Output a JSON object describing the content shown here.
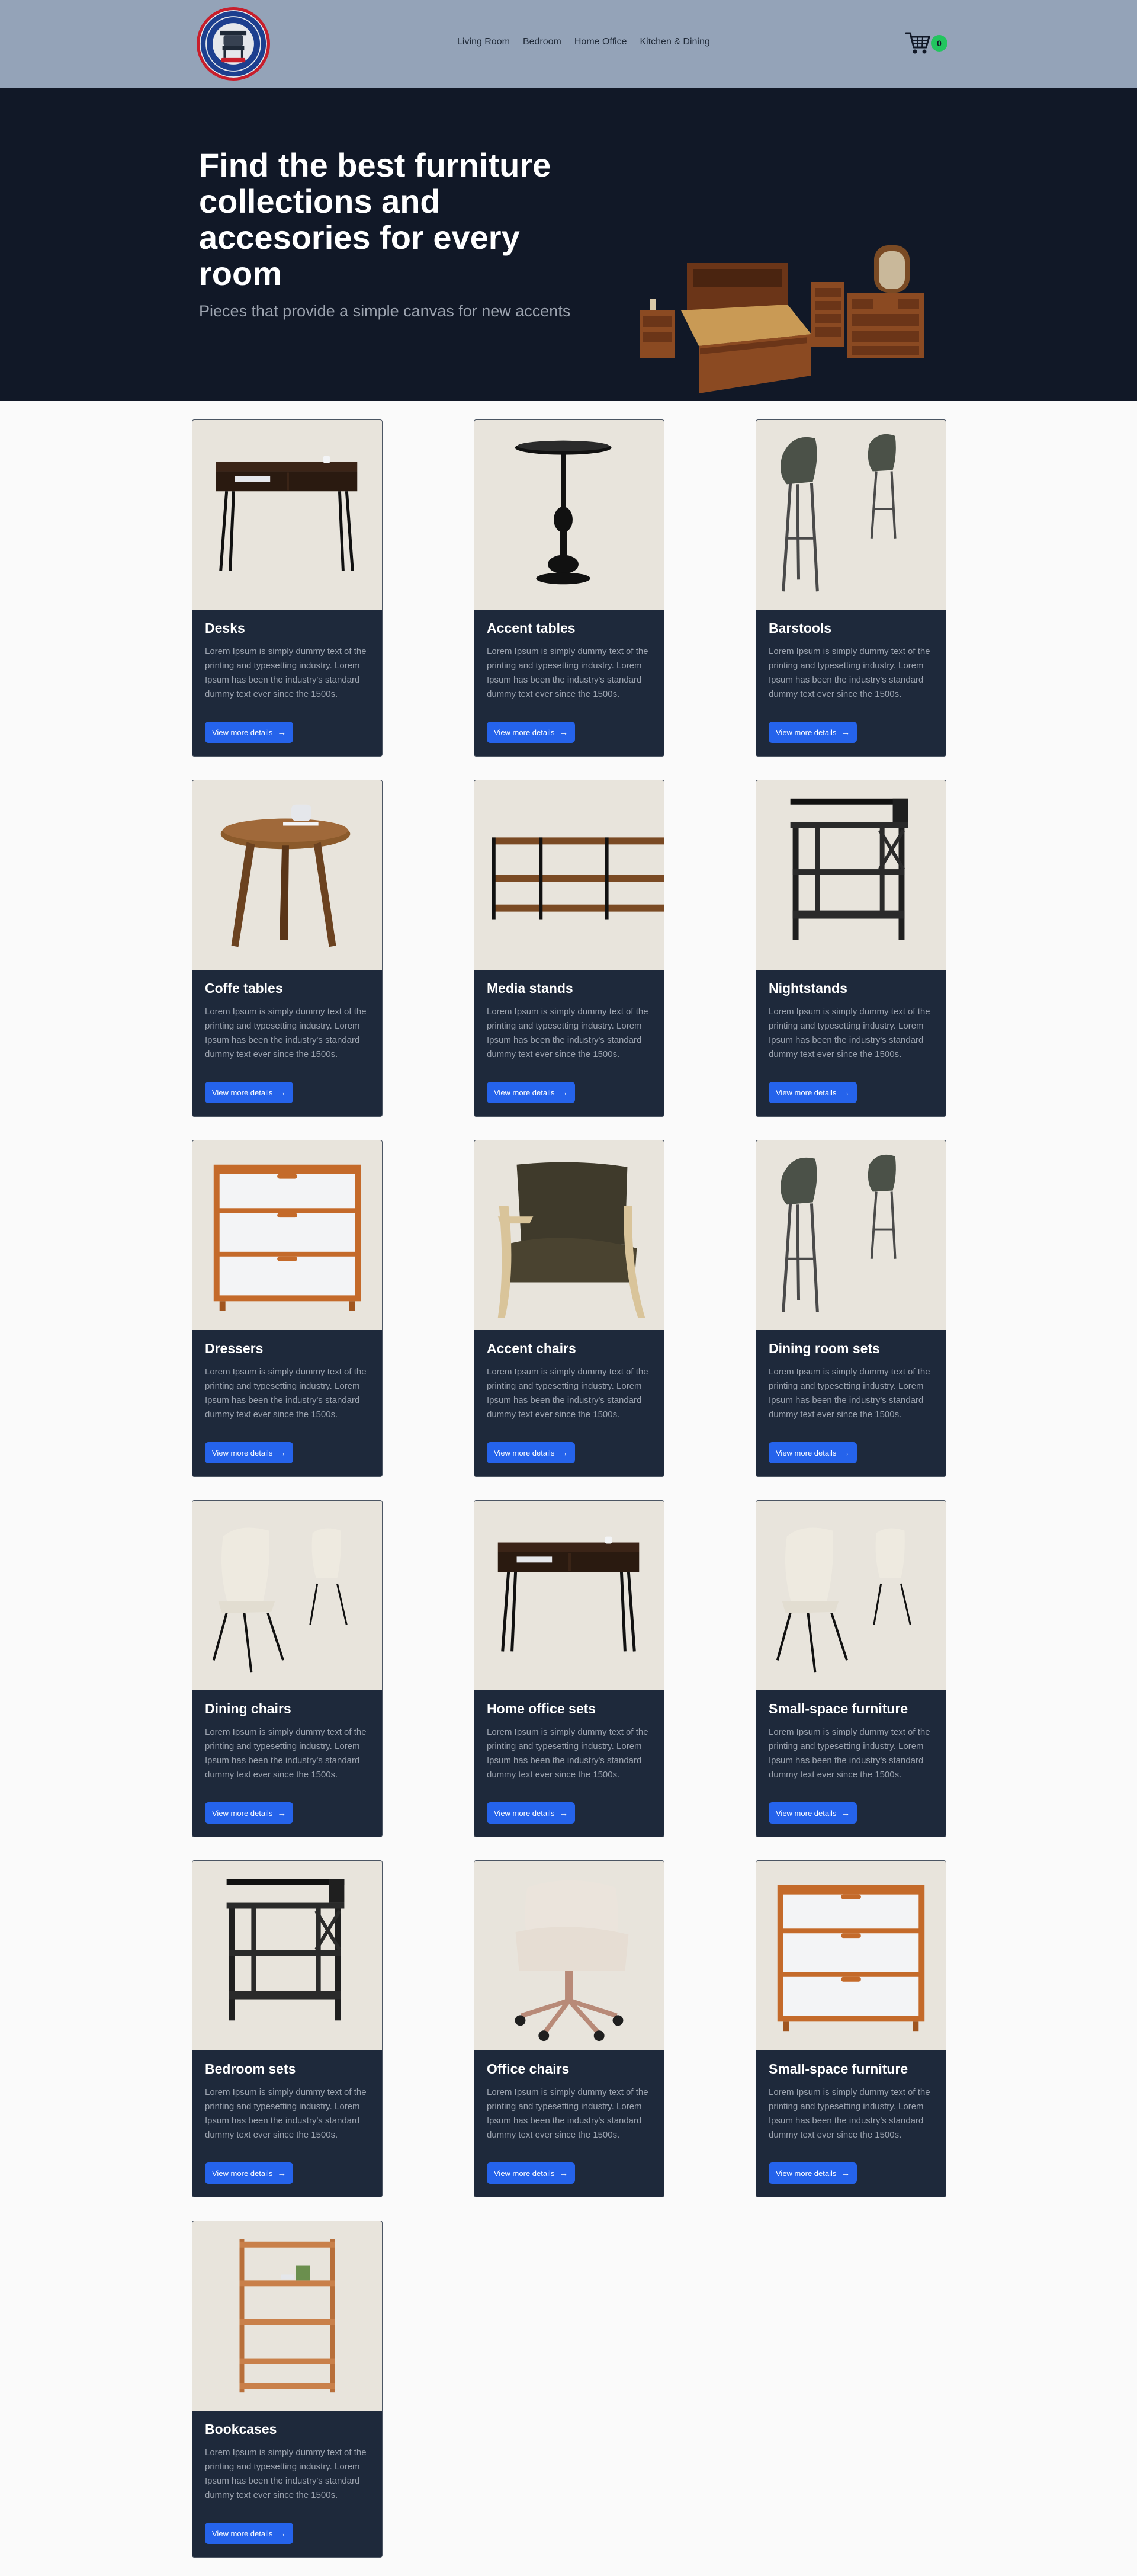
{
  "nav": {
    "items": [
      "Living Room",
      "Bedroom",
      "Home Office",
      "Kitchen & Dining"
    ]
  },
  "cart": {
    "count": "0"
  },
  "hero": {
    "title": "Find the best furniture collections and accesories for every room",
    "subtitle": "Pieces that provide a simple canvas for new accents"
  },
  "colors": {
    "header_bg": "#94a3b8",
    "hero_bg": "#111827",
    "card_bg": "#1e293b",
    "button_bg": "#2563eb",
    "cart_badge": "#22c55e"
  },
  "products": [
    {
      "title": "Desks",
      "desc": "Lorem Ipsum is simply dummy text of the printing and typesetting industry. Lorem Ipsum has been the industry's standard dummy text ever since the 1500s.",
      "button": "View more details",
      "image": "desk"
    },
    {
      "title": "Accent tables",
      "desc": "Lorem Ipsum is simply dummy text of the printing and typesetting industry. Lorem Ipsum has been the industry's standard dummy text ever since the 1500s.",
      "button": "View more details",
      "image": "accent-table"
    },
    {
      "title": "Barstools",
      "desc": "Lorem Ipsum is simply dummy text of the printing and typesetting industry. Lorem Ipsum has been the industry's standard dummy text ever since the 1500s.",
      "button": "View more details",
      "image": "barstools"
    },
    {
      "title": "Coffe tables",
      "desc": "Lorem Ipsum is simply dummy text of the printing and typesetting industry. Lorem Ipsum has been the industry's standard dummy text ever since the 1500s.",
      "button": "View more details",
      "image": "coffee-table"
    },
    {
      "title": "Media stands",
      "desc": "Lorem Ipsum is simply dummy text of the printing and typesetting industry. Lorem Ipsum has been the industry's standard dummy text ever since the 1500s.",
      "button": "View more details",
      "image": "media-stand"
    },
    {
      "title": "Nightstands",
      "desc": "Lorem Ipsum is simply dummy text of the printing and typesetting industry. Lorem Ipsum has been the industry's standard dummy text ever since the 1500s.",
      "button": "View more details",
      "image": "nightstand"
    },
    {
      "title": "Dressers",
      "desc": "Lorem Ipsum is simply dummy text of the printing and typesetting industry. Lorem Ipsum has been the industry's standard dummy text ever since the 1500s.",
      "button": "View more details",
      "image": "dresser"
    },
    {
      "title": "Accent chairs",
      "desc": "Lorem Ipsum is simply dummy text of the printing and typesetting industry. Lorem Ipsum has been the industry's standard dummy text ever since the 1500s.",
      "button": "View more details",
      "image": "accent-chair"
    },
    {
      "title": "Dining room sets",
      "desc": "Lorem Ipsum is simply dummy text of the printing and typesetting industry. Lorem Ipsum has been the industry's standard dummy text ever since the 1500s.",
      "button": "View more details",
      "image": "barstools"
    },
    {
      "title": "Dining chairs",
      "desc": "Lorem Ipsum is simply dummy text of the printing and typesetting industry. Lorem Ipsum has been the industry's standard dummy text ever since the 1500s.",
      "button": "View more details",
      "image": "dining-chairs"
    },
    {
      "title": "Home office sets",
      "desc": "Lorem Ipsum is simply dummy text of the printing and typesetting industry. Lorem Ipsum has been the industry's standard dummy text ever since the 1500s.",
      "button": "View more details",
      "image": "desk"
    },
    {
      "title": "Small-space furniture",
      "desc": "Lorem Ipsum is simply dummy text of the printing and typesetting industry. Lorem Ipsum has been the industry's standard dummy text ever since the 1500s.",
      "button": "View more details",
      "image": "dining-chairs"
    },
    {
      "title": "Bedroom sets",
      "desc": "Lorem Ipsum is simply dummy text of the printing and typesetting industry. Lorem Ipsum has been the industry's standard dummy text ever since the 1500s.",
      "button": "View more details",
      "image": "nightstand"
    },
    {
      "title": "Office chairs",
      "desc": "Lorem Ipsum is simply dummy text of the printing and typesetting industry. Lorem Ipsum has been the industry's standard dummy text ever since the 1500s.",
      "button": "View more details",
      "image": "office-chair"
    },
    {
      "title": "Small-space furniture",
      "desc": "Lorem Ipsum is simply dummy text of the printing and typesetting industry. Lorem Ipsum has been the industry's standard dummy text ever since the 1500s.",
      "button": "View more details",
      "image": "dresser"
    },
    {
      "title": "Bookcases",
      "desc": "Lorem Ipsum is simply dummy text of the printing and typesetting industry. Lorem Ipsum has been the industry's standard dummy text ever since the 1500s.",
      "button": "View more details",
      "image": "bookcase"
    }
  ]
}
